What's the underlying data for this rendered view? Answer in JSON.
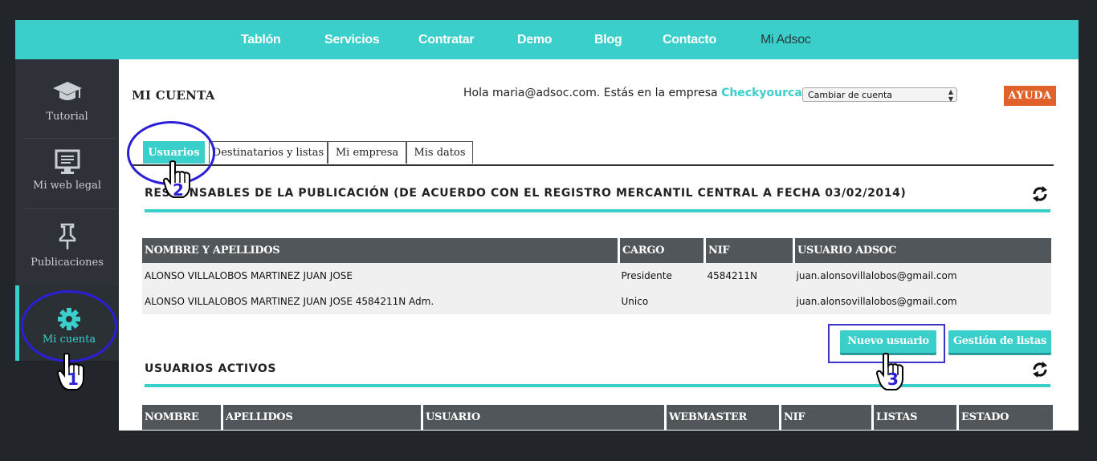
{
  "nav": {
    "items": [
      {
        "label": "Tablón"
      },
      {
        "label": "Servicios"
      },
      {
        "label": "Contratar"
      },
      {
        "label": "Demo"
      },
      {
        "label": "Blog"
      },
      {
        "label": "Contacto"
      },
      {
        "label": "Mi Adsoc"
      }
    ]
  },
  "sidebar": {
    "items": [
      {
        "label": "Tutorial",
        "icon": "graduation-cap-icon"
      },
      {
        "label": "Mi web legal",
        "icon": "monitor-icon"
      },
      {
        "label": "Publicaciones",
        "icon": "pushpin-icon"
      },
      {
        "label": "Mi cuenta",
        "icon": "gear-icon"
      }
    ]
  },
  "header": {
    "title": "MI CUENTA",
    "greeting": "Hola maria@adsoc.com. Estás en la empresa",
    "company": "Checkyourcar S.L.",
    "account_select": "Cambiar de cuenta",
    "help": "AYUDA"
  },
  "tabs": [
    {
      "label": "Usuarios"
    },
    {
      "label": "Destinatarios y listas"
    },
    {
      "label": "Mi empresa"
    },
    {
      "label": "Mis datos"
    }
  ],
  "responsables": {
    "title": "RESPONSABLES DE LA PUBLICACIÓN (DE ACUERDO CON EL REGISTRO MERCANTIL CENTRAL A FECHA 03/02/2014)",
    "columns": [
      "NOMBRE Y APELLIDOS",
      "CARGO",
      "NIF",
      "USUARIO ADSOC"
    ],
    "rows": [
      [
        "ALONSO VILLALOBOS MARTINEZ JUAN JOSE",
        "Presidente",
        "4584211N",
        "juan.alonsovillalobos@gmail.com"
      ],
      [
        "ALONSO VILLALOBOS MARTINEZ JUAN JOSE 4584211N Adm.",
        "Unico",
        "",
        "juan.alonsovillalobos@gmail.com"
      ]
    ]
  },
  "buttons": {
    "new_user": "Nuevo usuario",
    "lists": "Gestión de listas"
  },
  "activos": {
    "title": "USUARIOS ACTIVOS",
    "columns": [
      "NOMBRE",
      "APELLIDOS",
      "USUARIO",
      "WEBMASTER",
      "NIF",
      "LISTAS",
      "ESTADO"
    ]
  },
  "steps": [
    "1",
    "2",
    "3"
  ],
  "colors": {
    "accent": "#3bcfcb",
    "help": "#e0622a",
    "annotation": "#2a1fd6"
  }
}
